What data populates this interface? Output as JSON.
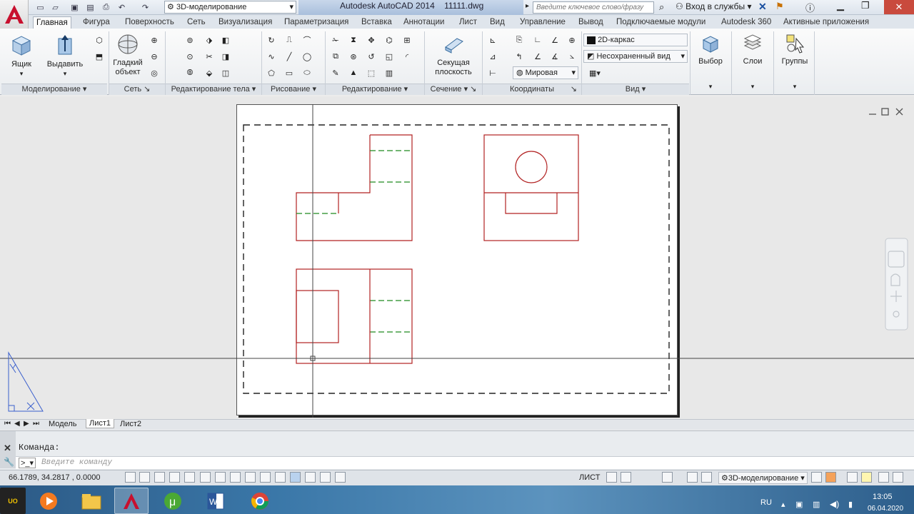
{
  "quick_access": {
    "workspace": "3D-моделирование"
  },
  "title": {
    "app": "Autodesk AutoCAD 2014",
    "file": "11111.dwg"
  },
  "search": {
    "placeholder": "Введите ключевое слово/фразу"
  },
  "signin": {
    "label": "Вход в службы"
  },
  "tabs": [
    "Главная",
    "Фигура",
    "Поверхность",
    "Сеть",
    "Визуализация",
    "Параметризация",
    "Вставка",
    "Аннотации",
    "Лист",
    "Вид",
    "Управление",
    "Вывод",
    "Подключаемые модули",
    "Autodesk 360",
    "Активные приложения"
  ],
  "ribbon": {
    "box_label": "Ящик",
    "extrude_label": "Выдавить",
    "smooth_label": "Гладкий объект",
    "section_plane_label": "Секущая плоскость",
    "visual_style": "2D-каркас",
    "view_state": "Несохраненный вид",
    "ucs": "Мировая",
    "select_label": "Выбор",
    "layers_label": "Слои",
    "groups_label": "Группы",
    "panels": {
      "modeling": "Моделирование",
      "mesh": "Сеть",
      "solid_edit": "Редактирование тела",
      "draw": "Рисование",
      "modify": "Редактирование",
      "section": "Сечение",
      "coordinates": "Координаты",
      "view": "Вид"
    }
  },
  "layout_tabs": [
    "Модель",
    "Лист1",
    "Лист2"
  ],
  "command": {
    "history": "Команда:",
    "placeholder": "Введите команду"
  },
  "status": {
    "coords": "66.1789, 34.2817 , 0.0000",
    "space": "ЛИСТ",
    "workspace": "3D-моделирование"
  },
  "taskbar": {
    "lang": "RU",
    "time": "13:05",
    "date": "06.04.2020"
  },
  "colors": {
    "geometry": "#b22222",
    "hidden": "#1f8a1f",
    "accent": "#c8102e"
  }
}
